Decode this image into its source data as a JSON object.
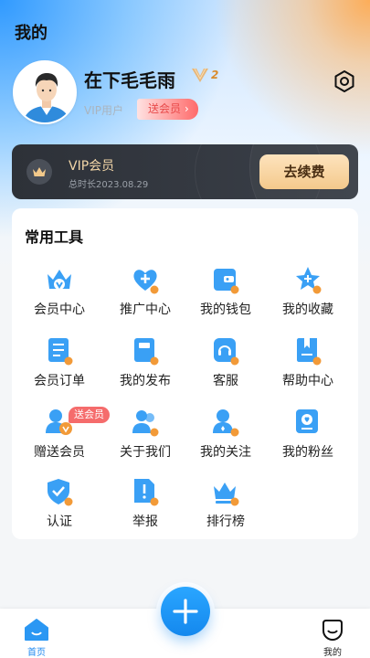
{
  "header": {
    "title": "我的"
  },
  "profile": {
    "username": "在下毛毛雨",
    "vip_level_letter": "V",
    "vip_level_number": "2",
    "user_type": "VIP用户",
    "gift_badge_label": "送会员",
    "gift_badge_chevron": "›"
  },
  "vip_card": {
    "title": "VIP会员",
    "expire": "总时长2023.08.29",
    "renew_label": "去续费"
  },
  "tools": {
    "title": "常用工具",
    "items": [
      {
        "label": "会员中心",
        "icon": "member-center-icon"
      },
      {
        "label": "推广中心",
        "icon": "promotion-center-icon"
      },
      {
        "label": "我的钱包",
        "icon": "wallet-icon"
      },
      {
        "label": "我的收藏",
        "icon": "favorites-icon"
      },
      {
        "label": "会员订单",
        "icon": "member-orders-icon"
      },
      {
        "label": "我的发布",
        "icon": "my-posts-icon"
      },
      {
        "label": "客服",
        "icon": "customer-service-icon"
      },
      {
        "label": "帮助中心",
        "icon": "help-center-icon"
      },
      {
        "label": "赠送会员",
        "icon": "gift-membership-icon"
      },
      {
        "label": "关于我们",
        "icon": "about-us-icon"
      },
      {
        "label": "我的关注",
        "icon": "following-icon"
      },
      {
        "label": "我的粉丝",
        "icon": "fans-icon"
      },
      {
        "label": "认证",
        "icon": "verification-icon"
      },
      {
        "label": "举报",
        "icon": "report-icon"
      },
      {
        "label": "排行榜",
        "icon": "leaderboard-icon"
      }
    ],
    "gift_tag": "送会员"
  },
  "tabbar": {
    "home_label": "首页",
    "me_label": "我的"
  },
  "colors": {
    "accent_blue": "#1E88F0",
    "icon_blue": "#3AA0F5",
    "icon_orange": "#F29A38",
    "gold": "#F3D7A8",
    "badge_red": "#F56C6C"
  }
}
